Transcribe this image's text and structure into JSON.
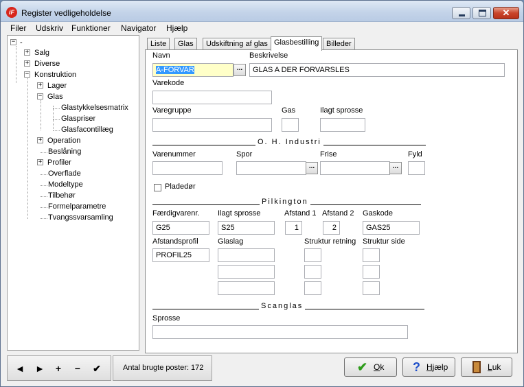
{
  "window": {
    "title": "Register vedligeholdelse",
    "app_icon_text": "iF"
  },
  "menu": [
    "Filer",
    "Udskriv",
    "Funktioner",
    "Navigator",
    "Hjælp"
  ],
  "tree": {
    "root": "-",
    "nodes": [
      {
        "label": "Salg",
        "expander": "+"
      },
      {
        "label": "Diverse",
        "expander": "+"
      },
      {
        "label": "Konstruktion",
        "expander": "−"
      },
      {
        "label": "Lager",
        "expander": "+"
      },
      {
        "label": "Glas",
        "expander": "−"
      },
      {
        "label": "Glastykkelsesmatrix",
        "expander": ""
      },
      {
        "label": "Glaspriser",
        "expander": ""
      },
      {
        "label": "Glasfacontillæg",
        "expander": ""
      },
      {
        "label": "Operation",
        "expander": "+"
      },
      {
        "label": "Beslåning",
        "expander": ""
      },
      {
        "label": "Profiler",
        "expander": "+"
      },
      {
        "label": "Overflade",
        "expander": ""
      },
      {
        "label": "Modeltype",
        "expander": ""
      },
      {
        "label": "Tilbehør",
        "expander": ""
      },
      {
        "label": "Formelparametre",
        "expander": ""
      },
      {
        "label": "Tvangssvarsamling",
        "expander": ""
      }
    ]
  },
  "tabs": [
    "Liste",
    "Glas",
    "Udskiftning af glas",
    "Glasbestilling",
    "Billeder"
  ],
  "active_tab": "Glasbestilling",
  "form": {
    "navn_label": "Navn",
    "navn_value": "A-FORVAR",
    "beskrivelse_label": "Beskrivelse",
    "beskrivelse_value": "GLAS A DER FORVARSLES",
    "varekode_label": "Varekode",
    "varekode_value": "",
    "varegruppe_label": "Varegruppe",
    "varegruppe_value": "",
    "gas_label": "Gas",
    "gas_value": "",
    "ilagt_sprosse_label": "Ilagt sprosse",
    "ilagt_sprosse_value": "",
    "ellipsis": "...",
    "oh_section": "O. H. Industri",
    "varenummer_label": "Varenummer",
    "varenummer_value": "",
    "spor_label": "Spor",
    "spor_value": "",
    "frise_label": "Frise",
    "frise_value": "",
    "fyld_label": "Fyld",
    "fyld_value": "",
    "pladedor_label": "Pladedør",
    "pladedor_checked": false,
    "pilkington_section": "Pilkington",
    "faerdigvarenr_label": "Færdigvarenr.",
    "faerdigvarenr_value": "G25",
    "pk_ilagt_sprosse_label": "Ilagt sprosse",
    "pk_ilagt_sprosse_value": "S25",
    "afstand1_label": "Afstand 1",
    "afstand1_value": "1",
    "afstand2_label": "Afstand 2",
    "afstand2_value": "2",
    "gaskode_label": "Gaskode",
    "gaskode_value": "GAS25",
    "afstandsprofil_label": "Afstandsprofil",
    "afstandsprofil_value": "PROFIL25",
    "glaslag_label": "Glaslag",
    "glaslag_values": [
      "",
      "",
      ""
    ],
    "struktur_retning_label": "Struktur retning",
    "struktur_retning_values": [
      "",
      "",
      ""
    ],
    "struktur_side_label": "Struktur side",
    "struktur_side_values": [
      "",
      "",
      ""
    ],
    "scanglas_section": "Scanglas",
    "sprosse_label": "Sprosse",
    "sprosse_value": ""
  },
  "nav_buttons": [
    "◄",
    "►",
    "+",
    "−",
    "✔"
  ],
  "status": "Antal brugte poster: 172",
  "buttons": {
    "ok": {
      "label": "Ok",
      "accel": "O",
      "rest": "k",
      "icon": "checkmark-icon"
    },
    "help": {
      "label": "Hjælp",
      "accel": "H",
      "rest": "jælp",
      "icon": "question-icon"
    },
    "close": {
      "label": "Luk",
      "accel": "L",
      "rest": "uk",
      "icon": "door-icon"
    }
  },
  "colors": {
    "checkmark": "#2e9c1b",
    "question": "#1f4fc9",
    "selection": "#3399ff",
    "focus_field": "#ffffc8"
  }
}
